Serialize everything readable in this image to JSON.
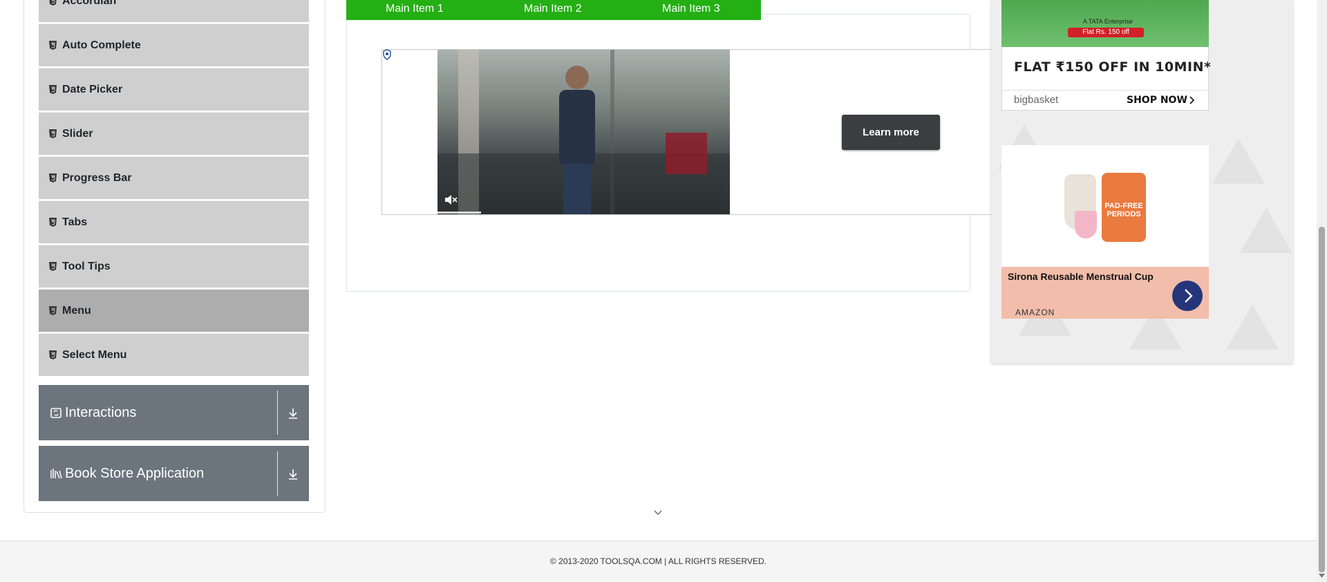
{
  "sidebar": {
    "items": [
      {
        "label": "Accordian",
        "active": false
      },
      {
        "label": "Auto Complete",
        "active": false
      },
      {
        "label": "Date Picker",
        "active": false
      },
      {
        "label": "Slider",
        "active": false
      },
      {
        "label": "Progress Bar",
        "active": false
      },
      {
        "label": "Tabs",
        "active": false
      },
      {
        "label": "Tool Tips",
        "active": false
      },
      {
        "label": "Menu",
        "active": true
      },
      {
        "label": "Select Menu",
        "active": false
      }
    ],
    "groups": [
      {
        "title": "Interactions",
        "icon": "interactions-icon"
      },
      {
        "title": "Book Store Application",
        "icon": "book-store-icon"
      }
    ]
  },
  "menu_bar": {
    "items": [
      "Main Item 1",
      "Main Item 2",
      "Main Item 3"
    ],
    "color": "#24af15"
  },
  "video_ad": {
    "cta": "Learn more",
    "progress_fraction": 0.15
  },
  "right_ads": {
    "bigbasket": {
      "offer": "Flat Rs. 150 off",
      "tagline": "A TATA Enterprise",
      "headline": "FLAT ₹150 OFF IN 10MIN*",
      "brand": "bigbasket",
      "cta": "SHOP NOW"
    },
    "sirona": {
      "product_text": "PAD-FREE PERIODS",
      "title": "Sirona Reusable Menstrual Cup",
      "store": "AMAZON"
    }
  },
  "footer": {
    "text": "© 2013-2020 TOOLSQA.COM | ALL RIGHTS RESERVED."
  }
}
